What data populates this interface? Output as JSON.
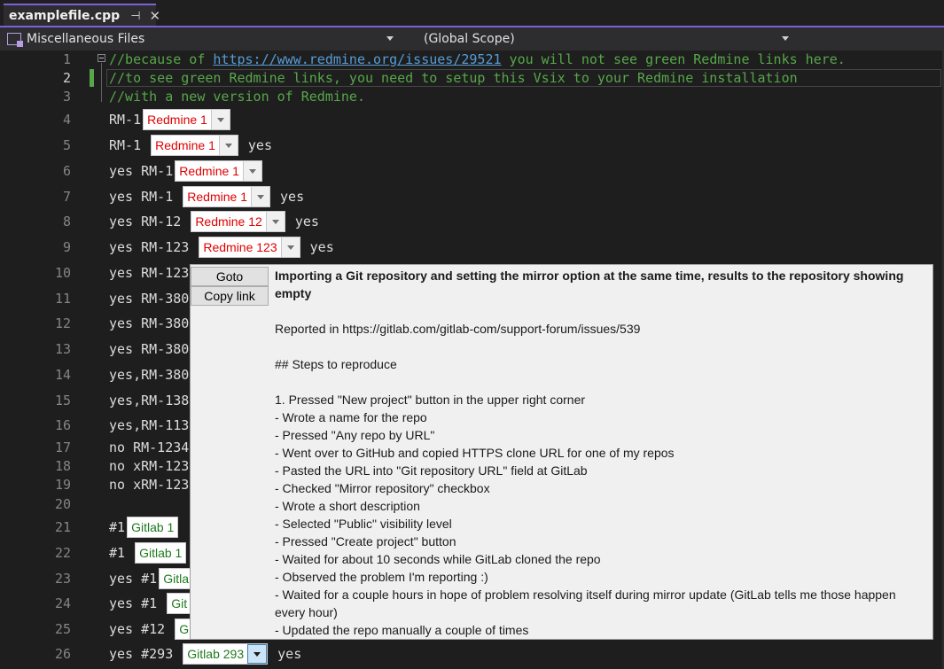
{
  "tab": {
    "title": "examplefile.cpp",
    "pin": "⊣",
    "close": "✕"
  },
  "nav": {
    "project": "Miscellaneous Files",
    "scope": "(Global Scope)"
  },
  "gutter": [
    "1",
    "2",
    "3",
    "4",
    "5",
    "6",
    "7",
    "8",
    "9",
    "10",
    "11",
    "12",
    "13",
    "14",
    "15",
    "16",
    "17",
    "18",
    "19",
    "20",
    "21",
    "22",
    "23",
    "24",
    "25",
    "26"
  ],
  "code": {
    "l1_a": "//because of ",
    "l1_link": "https://www.redmine.org/issues/29521",
    "l1_b": " you will not see green Redmine links here.",
    "l2": "//to see green Redmine links, you need to setup this Vsix to your Redmine installation",
    "l3": "//with a new version of Redmine.",
    "l4": "RM-1",
    "l4_chip": "Redmine 1",
    "l5": "RM-1 ",
    "l5_chip": "Redmine 1",
    "l5_tail": " yes",
    "l6": "yes RM-1",
    "l6_chip": "Redmine 1",
    "l7": "yes RM-1 ",
    "l7_chip": "Redmine 1",
    "l7_tail": " yes",
    "l8": "yes RM-12 ",
    "l8_chip": "Redmine 12",
    "l8_tail": " yes",
    "l9": "yes RM-123 ",
    "l9_chip": "Redmine 123",
    "l9_tail": " yes",
    "l10": "yes RM-123",
    "l11": "yes RM-380",
    "l12": "yes RM-380",
    "l13": "yes RM-380",
    "l14": "yes,RM-380",
    "l15": "yes,RM-138",
    "l16": "yes,RM-113",
    "l17": "no RM-1234",
    "l18": "no xRM-123",
    "l19": "no xRM-123",
    "l21": "#1",
    "l21_chip": "Gitlab 1",
    "l22": "#1 ",
    "l22_chip": "Gitlab 1",
    "l23": "yes #1",
    "l23_chip": "Gitla",
    "l24": "yes #1 ",
    "l24_chip": "Git",
    "l25": "yes #12 ",
    "l25_chip": "G",
    "l26": "yes #293 ",
    "l26_chip": "Gitlab 293",
    "l26_tail": " yes"
  },
  "popup": {
    "goto": "Goto",
    "copy": "Copy link",
    "title": "Importing a Git repository and setting the mirror option at the same time, results to the repository showing empty",
    "lines": [
      "",
      "Reported in https://gitlab.com/gitlab-com/support-forum/issues/539",
      "",
      "## Steps to reproduce",
      "",
      "1. Pressed \"New project\" button in the upper right corner",
      "- Wrote a name for the repo",
      "- Pressed \"Any repo by URL\"",
      "- Went over to GitHub and copied HTTPS clone URL for one of my repos",
      "- Pasted the URL into \"Git repository URL\" field at GitLab",
      "- Checked \"Mirror repository\" checkbox",
      "- Wrote a short description",
      "- Selected \"Public\" visibility level",
      "- Pressed \"Create project\" button",
      "- Waited for about 10 seconds while GitLab cloned the repo",
      "- Observed the problem I'm reporting :)",
      "- Waited for a couple hours in hope of problem resolving itself during mirror update (GitLab tells me those happen every hour)",
      "- Updated the repo manually a couple of times"
    ]
  },
  "colors": {
    "accent": "#7d5fd6",
    "comment": "#57a64a",
    "link": "#569cd6",
    "redmine": "#e00000",
    "gitlab": "#1e7a1e"
  }
}
